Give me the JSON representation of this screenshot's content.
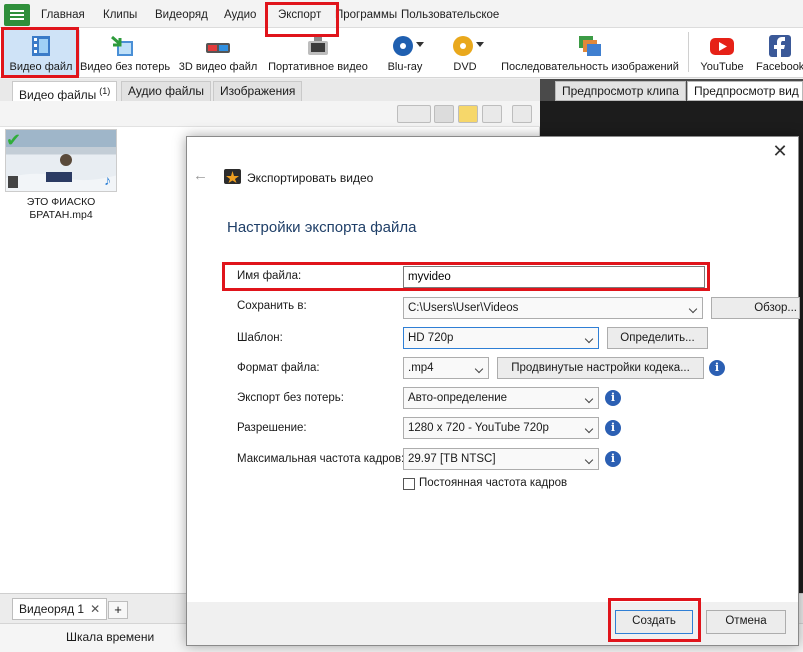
{
  "menubar": {
    "items": [
      "Главная",
      "Клипы",
      "Видеоряд",
      "Аудио",
      "Экспорт",
      "Программы",
      "Пользовательское"
    ]
  },
  "toolbar": {
    "buttons": [
      {
        "label": "Видео файл",
        "icon": "film-export-icon"
      },
      {
        "label": "Видео без потерь",
        "icon": "lossless-video-icon"
      },
      {
        "label": "3D видео файл",
        "icon": "3d-glasses-icon"
      },
      {
        "label": "Портативное видео",
        "icon": "portable-device-icon"
      },
      {
        "label": "Blu-ray",
        "icon": "bluray-disc-icon"
      },
      {
        "label": "DVD",
        "icon": "dvd-disc-icon"
      },
      {
        "label": "Последовательность изображений",
        "icon": "image-sequence-icon"
      },
      {
        "label": "YouTube",
        "icon": "youtube-icon"
      },
      {
        "label": "Facebook",
        "icon": "facebook-icon"
      }
    ]
  },
  "file_tabs": {
    "video": "Видео файлы",
    "video_count": "(1)",
    "audio": "Аудио файлы",
    "images": "Изображения"
  },
  "file_list": [
    {
      "name": "ЭТО ФИАСКО БРАТАН.mp4"
    }
  ],
  "preview_tabs": [
    "Предпросмотр клипа",
    "Предпросмотр вид"
  ],
  "sequence": {
    "tab_label": "Видеоряд 1",
    "close": "✕",
    "add": "+"
  },
  "timeline": {
    "label": "Шкала времени"
  },
  "dialog": {
    "title": "Экспортировать видео",
    "heading": "Настройки экспорта файла",
    "fields": {
      "filename": {
        "label": "Имя файла:",
        "value": "myvideo"
      },
      "save_to": {
        "label": "Сохранить в:",
        "value": "C:\\Users\\User\\Videos",
        "button": "Обзор..."
      },
      "template": {
        "label": "Шаблон:",
        "value": "HD 720p",
        "button": "Определить..."
      },
      "format": {
        "label": "Формат файла:",
        "value": ".mp4",
        "button": "Продвинутые настройки кодека..."
      },
      "lossless": {
        "label": "Экспорт без потерь:",
        "value": "Авто-определение"
      },
      "resolution": {
        "label": "Разрешение:",
        "value": "1280 x 720 - YouTube 720p"
      },
      "framerate": {
        "label": "Максимальная частота кадров:",
        "value": "29.97 [ТВ NTSC]"
      }
    },
    "constant_fps": {
      "label": "Постоянная частота кадров",
      "checked": false
    },
    "buttons": {
      "create": "Создать",
      "cancel": "Отмена"
    }
  },
  "colors": {
    "highlight": "#e0141b",
    "accent": "#2f8f3b",
    "heading": "#1f3f68"
  }
}
